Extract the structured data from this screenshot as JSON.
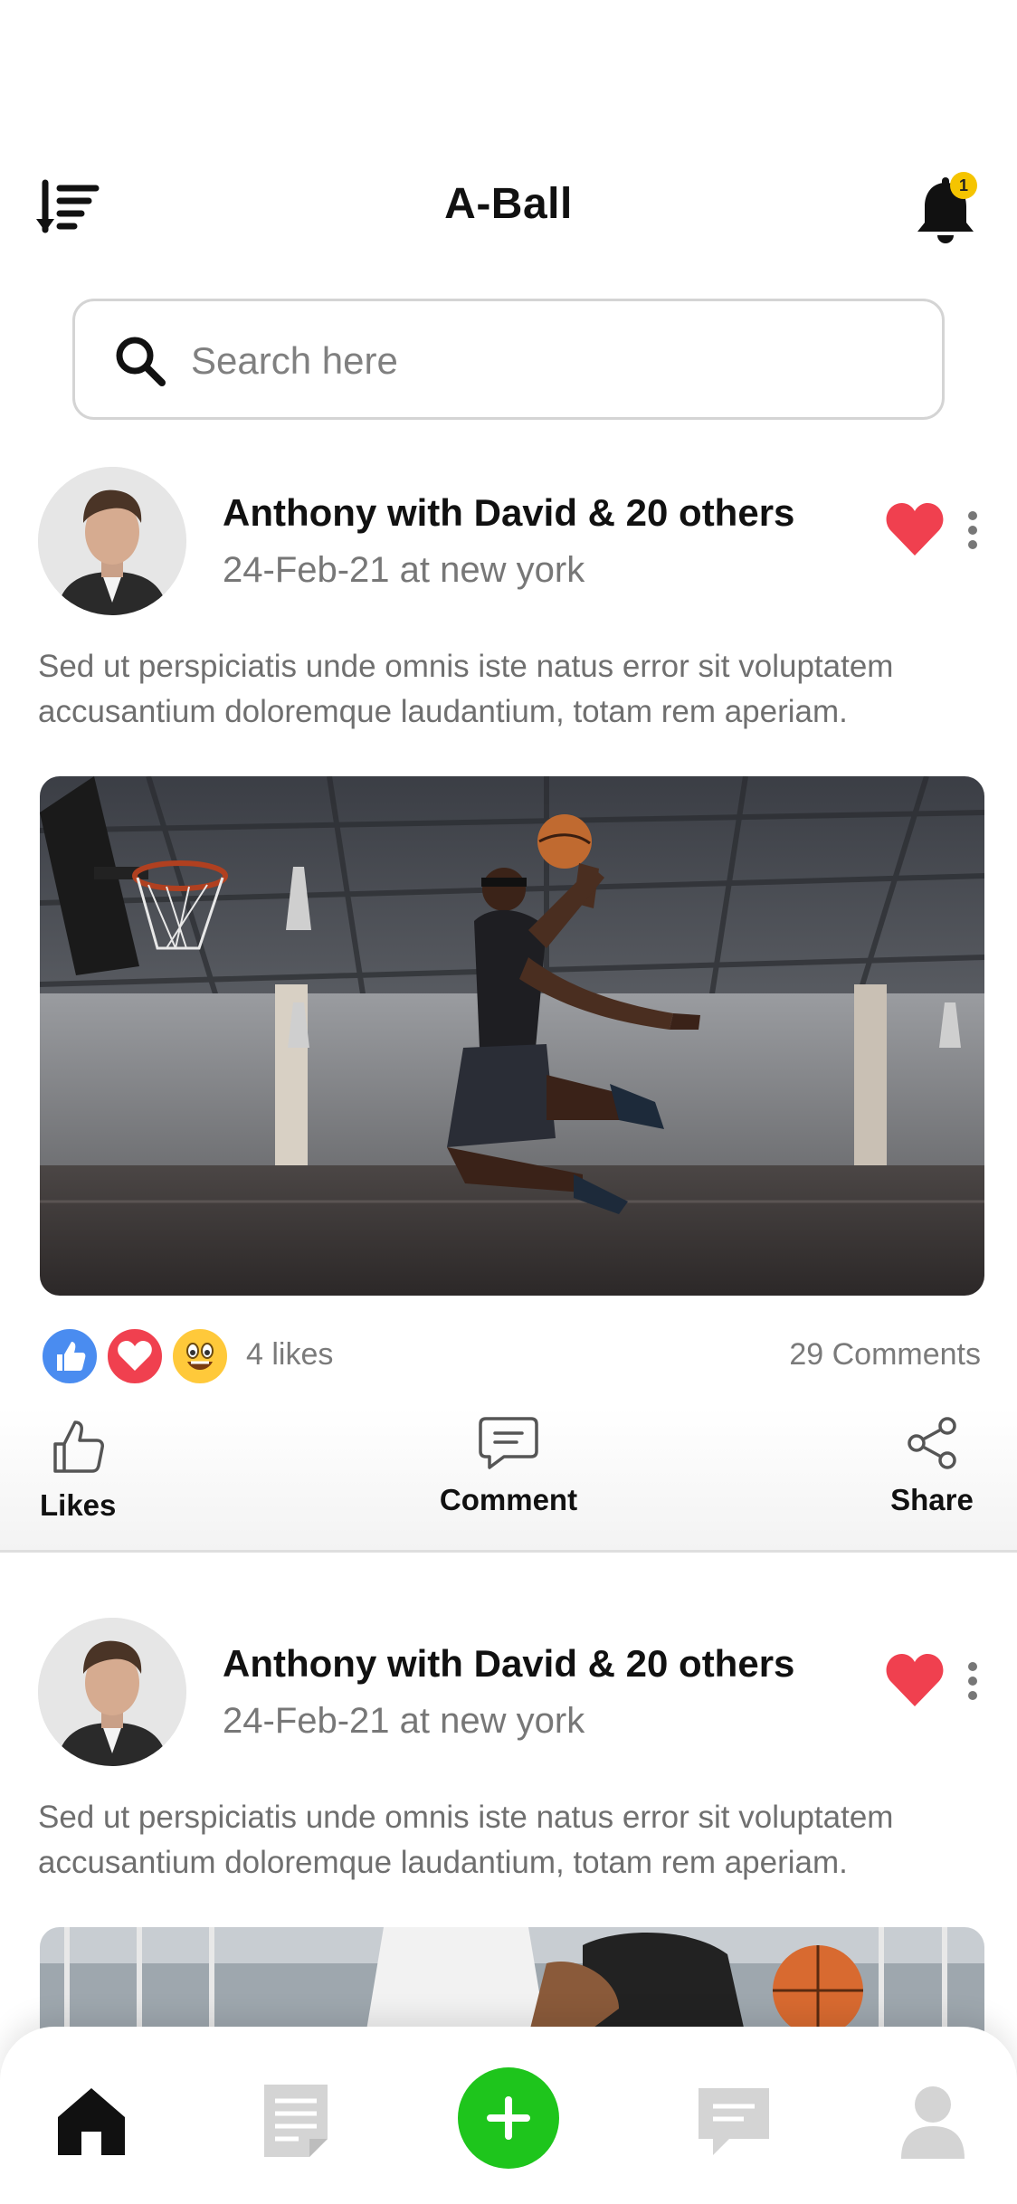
{
  "header": {
    "title": "A-Ball",
    "notification_count": "1",
    "sort_icon": "sort-descending-icon",
    "bell_icon": "bell-icon"
  },
  "search": {
    "placeholder": "Search here",
    "icon": "search-icon"
  },
  "posts": [
    {
      "author": "Anthony with David & 20 others",
      "meta": "24-Feb-21 at new york",
      "text": "Sed ut perspiciatis unde omnis iste natus error sit voluptatem accusantium doloremque laudantium, totam rem aperiam.",
      "liked": true,
      "image": "basketball-dunk-photo",
      "likes": "4 likes",
      "comments": "29 Comments",
      "reactions": [
        "thumbs-up-icon",
        "heart-icon",
        "laughing-emoji-icon"
      ]
    },
    {
      "author": "Anthony with David & 20 others",
      "meta": "24-Feb-21 at new york",
      "text": "Sed ut perspiciatis unde omnis iste natus error sit voluptatem accusantium doloremque laudantium, totam rem aperiam.",
      "liked": true,
      "image": "basketball-players-photo"
    }
  ],
  "actions": {
    "likes": "Likes",
    "comment": "Comment",
    "share": "Share"
  },
  "bottom_nav": {
    "items": [
      "home-icon",
      "document-icon",
      "add-icon",
      "chat-icon",
      "profile-icon"
    ],
    "active": "home"
  },
  "colors": {
    "accent_green": "#1ec51c",
    "heart_red": "#f0404f",
    "badge_yellow": "#f5c400",
    "like_blue": "#4a8cf0"
  }
}
